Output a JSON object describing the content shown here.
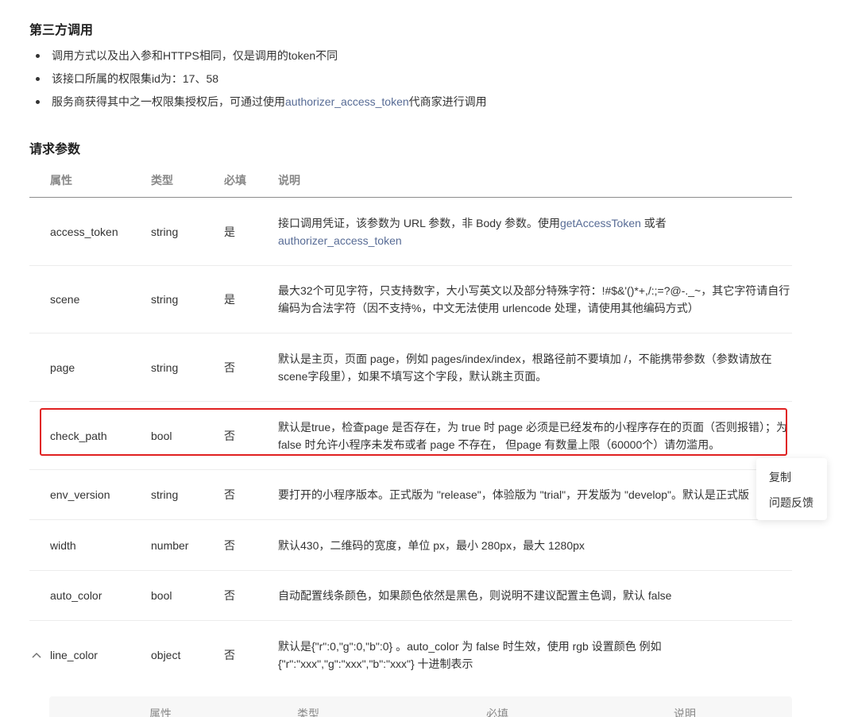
{
  "third_party": {
    "title": "第三方调用",
    "bullets": [
      {
        "text": "调用方式以及出入参和HTTPS相同，仅是调用的token不同"
      },
      {
        "text": "该接口所属的权限集id为：17、58"
      },
      {
        "before": "服务商获得其中之一权限集授权后，可通过使用",
        "link": "authorizer_access_token",
        "after": "代商家进行调用"
      }
    ]
  },
  "request_params": {
    "title": "请求参数",
    "headers": [
      "属性",
      "类型",
      "必填",
      "说明"
    ],
    "rows": [
      {
        "name": "access_token",
        "type": "string",
        "required": "是",
        "desc_before": "接口调用凭证，该参数为 URL 参数，非 Body 参数。使用",
        "desc_link1": "getAccessToken",
        "desc_mid": " 或者 ",
        "desc_link2": "authorizer_access_token"
      },
      {
        "name": "scene",
        "type": "string",
        "required": "是",
        "desc": "最大32个可见字符，只支持数字，大小写英文以及部分特殊字符：!#$&'()*+,/:;=?@-._~，其它字符请自行编码为合法字符（因不支持%，中文无法使用 urlencode 处理，请使用其他编码方式）"
      },
      {
        "name": "page",
        "type": "string",
        "required": "否",
        "desc": "默认是主页，页面 page，例如 pages/index/index，根路径前不要填加 /，不能携带参数（参数请放在scene字段里），如果不填写这个字段，默认跳主页面。"
      },
      {
        "name": "check_path",
        "type": "bool",
        "required": "否",
        "desc": "默认是true，检查page 是否存在，为 true 时 page 必须是已经发布的小程序存在的页面（否则报错）；为 false 时允许小程序未发布或者 page 不存在， 但page 有数量上限（60000个）请勿滥用。"
      },
      {
        "name": "env_version",
        "type": "string",
        "required": "否",
        "desc": "要打开的小程序版本。正式版为 \"release\"，体验版为 \"trial\"，开发版为 \"develop\"。默认是正式版"
      },
      {
        "name": "width",
        "type": "number",
        "required": "否",
        "desc": "默认430，二维码的宽度，单位 px，最小 280px，最大 1280px"
      },
      {
        "name": "auto_color",
        "type": "bool",
        "required": "否",
        "desc": "自动配置线条颜色，如果颜色依然是黑色，则说明不建议配置主色调，默认 false"
      },
      {
        "name": "line_color",
        "type": "object",
        "required": "否",
        "desc": "默认是{\"r\":0,\"g\":0,\"b\":0} 。auto_color 为 false 时生效，使用 rgb 设置颜色 例如 {\"r\":\"xxx\",\"g\":\"xxx\",\"b\":\"xxx\"} 十进制表示",
        "expand_icon": "chevron-up-icon"
      }
    ],
    "sub_headers": [
      "属性",
      "类型",
      "必填",
      "说明"
    ]
  },
  "context_menu": {
    "items": [
      "复制",
      "问题反馈"
    ]
  },
  "colors": {
    "link": "#576b95",
    "highlight_border": "#e02020"
  }
}
